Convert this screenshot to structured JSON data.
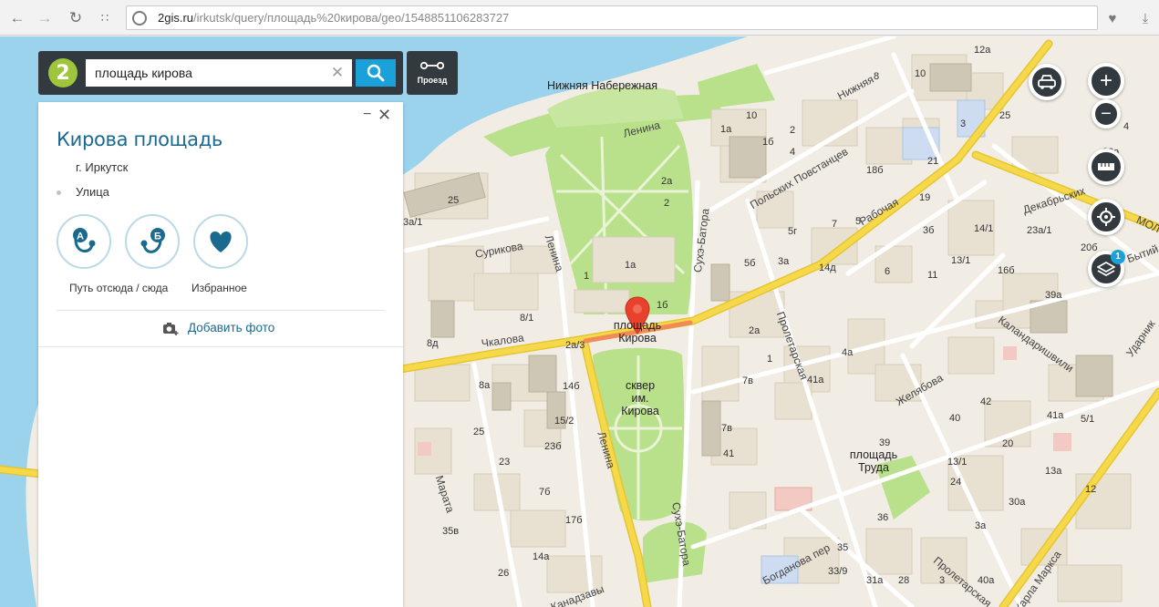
{
  "browser": {
    "url_host": "2gis.ru",
    "url_path": "/irkutsk/query/площадь%20кирова/geo/1548851106283727"
  },
  "search": {
    "query": "площадь кирова",
    "route_label": "Проезд"
  },
  "card": {
    "title": "Кирова площадь",
    "city": "г. Иркутск",
    "type": "Улица",
    "actions": [
      {
        "label": "Путь отсюда / сюда"
      },
      {
        "label": "Избранное"
      }
    ],
    "add_photo": "Добавить фото"
  },
  "map": {
    "marker_label": "площадь\nКирова",
    "places": [
      {
        "text": "сквер\nим. Кирова"
      },
      {
        "text": "площадь\nТруда"
      },
      {
        "text": "Нижняя Набережная"
      }
    ],
    "streets": [
      "Ленина",
      "Ленина",
      "Ленина",
      "Сурикова",
      "Чкалова",
      "Сухэ-Батора",
      "Сухэ-Батора",
      "Польских Повстанцев",
      "Рабочая",
      "Пролетарская",
      "Пролетарская",
      "Желябова",
      "Каландаришвили",
      "Декабрьских",
      "Марата",
      "Богданова пер",
      "Канадзавы",
      "Карла Маркса",
      "Нижняя",
      "Ударник",
      "Бытий",
      "МОЛ"
    ],
    "house_numbers": [
      "12а",
      "10",
      "8",
      "25",
      "1а",
      "10",
      "3",
      "1б",
      "4",
      "2а",
      "2",
      "1",
      "1а",
      "1б",
      "21",
      "18б",
      "19",
      "25",
      "3а/1",
      "5",
      "5г",
      "7",
      "3б",
      "5б",
      "3а",
      "14д",
      "6",
      "11",
      "13/1",
      "14/1",
      "23а/1",
      "16б",
      "39а",
      "8/1",
      "2а/3",
      "2а",
      "1",
      "7в",
      "4а",
      "41а",
      "42",
      "41а",
      "5/1",
      "8д",
      "8а",
      "14б",
      "15/2",
      "25",
      "23б",
      "23",
      "7б",
      "7в",
      "41",
      "40",
      "20",
      "17б",
      "35в",
      "35",
      "33/9",
      "30а",
      "12",
      "36",
      "3а",
      "14а",
      "26",
      "28",
      "31а",
      "3",
      "40а",
      "13а",
      "39",
      "13/1",
      "24",
      "20а",
      "20б",
      "26",
      "4",
      "2"
    ],
    "zoom_in": "+",
    "zoom_out": "−",
    "layers_badge": "1"
  },
  "colors": {
    "water": "#9bd3ed",
    "park": "#b9e08a",
    "road_major": "#f6d94b",
    "accent": "#1ba1d9",
    "marker": "#e8412c",
    "title": "#1a6a8f"
  }
}
